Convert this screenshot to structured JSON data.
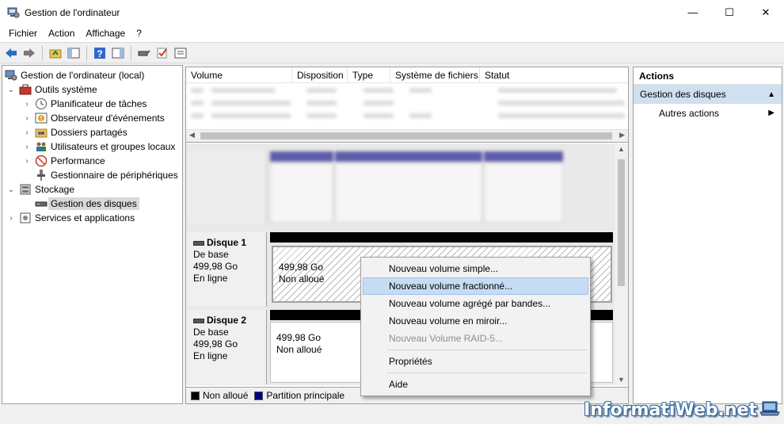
{
  "window": {
    "title": "Gestion de l'ordinateur",
    "controls": {
      "minimize": "—",
      "maximize": "☐",
      "close": "✕"
    }
  },
  "menu": [
    "Fichier",
    "Action",
    "Affichage",
    "?"
  ],
  "toolbar": {
    "icons": [
      "back-arrow-icon",
      "forward-arrow-icon",
      "up-folder-icon",
      "show-hide-tree-icon",
      "help-icon",
      "show-hide-action-pane-icon",
      "connect-disk-icon",
      "check-icon",
      "properties-icon"
    ]
  },
  "tree": {
    "root": "Gestion de l'ordinateur (local)",
    "system_tools": "Outils système",
    "system_items": [
      "Planificateur de tâches",
      "Observateur d'événements",
      "Dossiers partagés",
      "Utilisateurs et groupes locaux",
      "Performance",
      "Gestionnaire de périphériques"
    ],
    "storage": "Stockage",
    "storage_items": [
      "Gestion des disques"
    ],
    "services": "Services et applications"
  },
  "volumes": {
    "columns": [
      "Volume",
      "Disposition",
      "Type",
      "Système de fichiers",
      "Statut"
    ]
  },
  "disks": [
    {
      "name": "Disque 1",
      "type": "De base",
      "size": "499,98 Go",
      "state": "En ligne",
      "partition_size": "499,98 Go",
      "partition_state": "Non alloué"
    },
    {
      "name": "Disque 2",
      "type": "De base",
      "size": "499,98 Go",
      "state": "En ligne",
      "partition_size": "499,98 Go",
      "partition_state": "Non alloué"
    }
  ],
  "legend": [
    {
      "label": "Non alloué",
      "color": "#000000"
    },
    {
      "label": "Partition principale",
      "color": "#00007f"
    }
  ],
  "actions": {
    "title": "Actions",
    "section": "Gestion des disques",
    "more": "Autres actions"
  },
  "context_menu": {
    "items": [
      {
        "label": "Nouveau volume simple...",
        "state": "normal"
      },
      {
        "label": "Nouveau volume fractionné...",
        "state": "highlighted"
      },
      {
        "label": "Nouveau volume agrégé par bandes...",
        "state": "normal"
      },
      {
        "label": "Nouveau volume en miroir...",
        "state": "normal"
      },
      {
        "label": "Nouveau Volume RAID-5...",
        "state": "disabled"
      }
    ],
    "properties": "Propriétés",
    "help": "Aide"
  },
  "watermark": "InformatiWeb.net",
  "colors": {
    "accent_selection": "#cfe0f0",
    "menu_highlight": "#c5dcf4",
    "disk_header_bar": "#000000",
    "primary_partition": "#00007f"
  }
}
